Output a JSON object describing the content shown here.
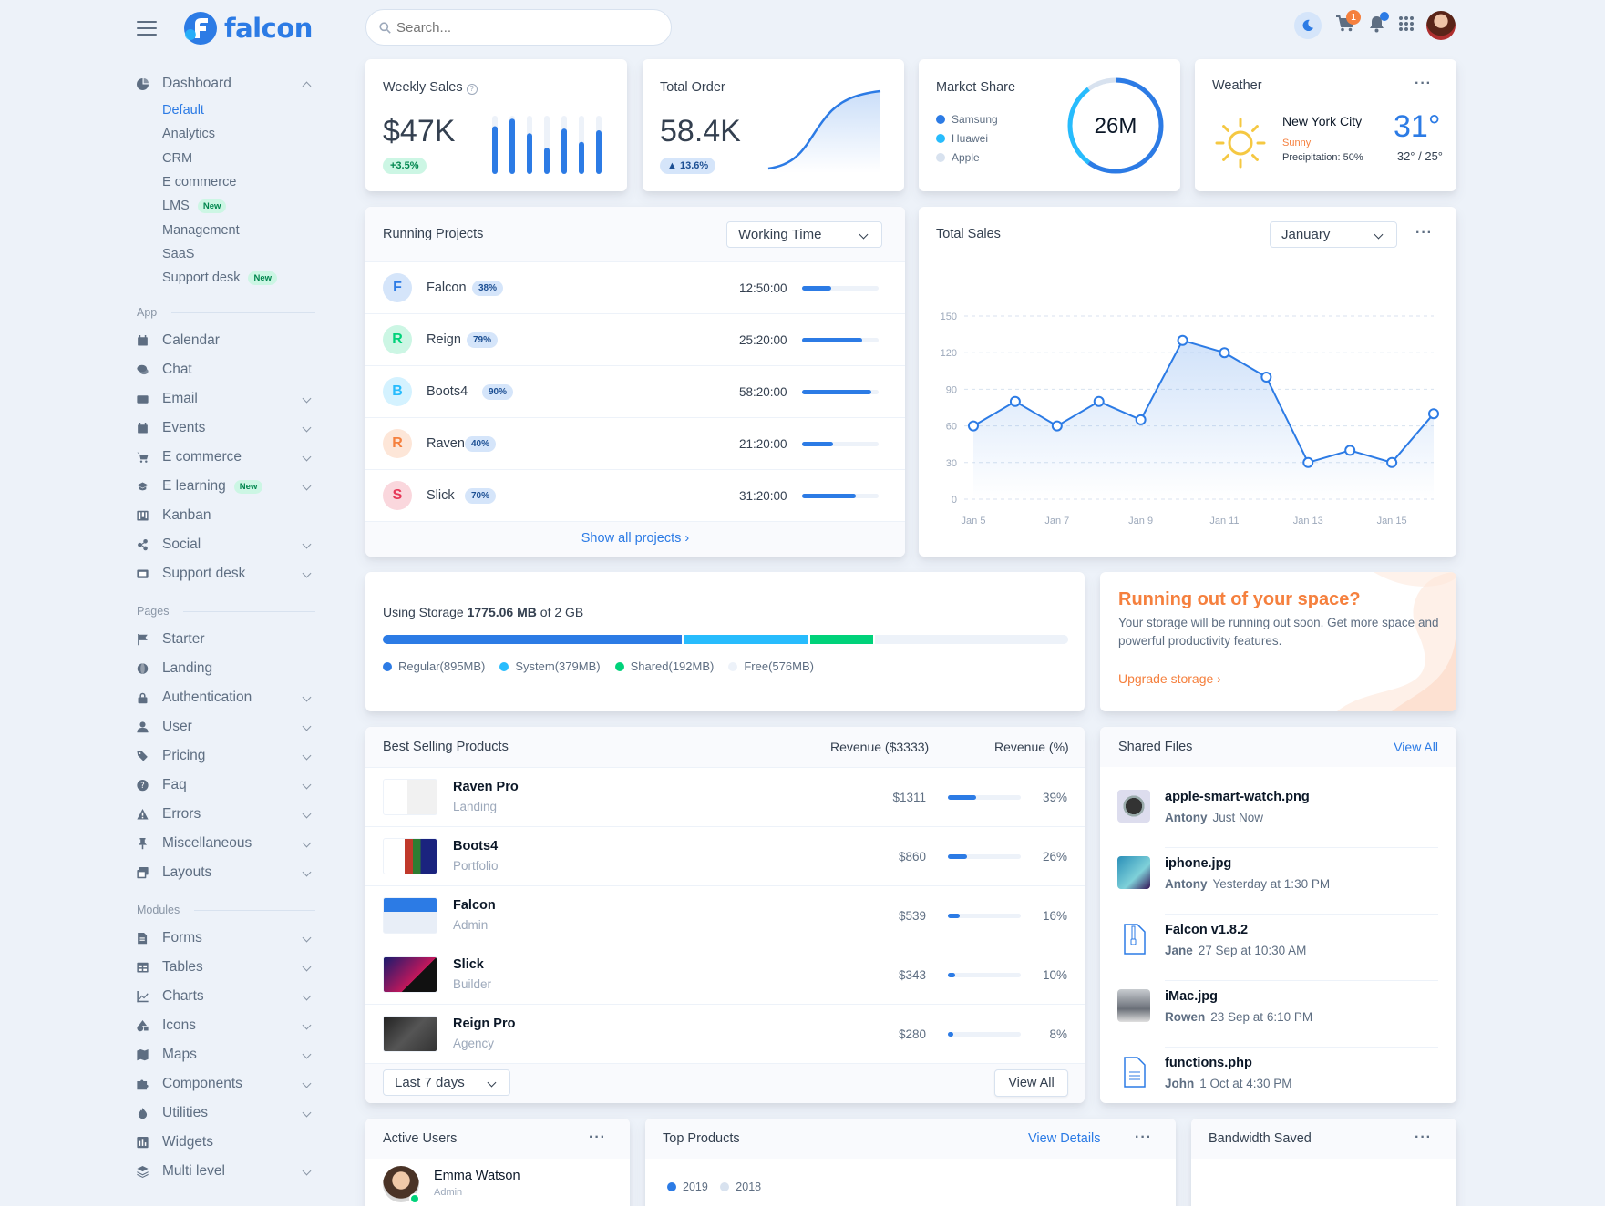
{
  "brand": {
    "name": "falcon"
  },
  "search": {
    "placeholder": "Search..."
  },
  "topbar": {
    "cart_count": "1"
  },
  "sidebar": {
    "dashboard": {
      "label": "Dashboard",
      "items": [
        {
          "label": "Default",
          "active": true
        },
        {
          "label": "Analytics"
        },
        {
          "label": "CRM"
        },
        {
          "label": "E commerce"
        },
        {
          "label": "LMS",
          "badge": "New"
        },
        {
          "label": "Management"
        },
        {
          "label": "SaaS"
        },
        {
          "label": "Support desk",
          "badge": "New"
        }
      ]
    },
    "app_label": "App",
    "app": [
      {
        "label": "Calendar",
        "icon": "calendar-icon",
        "chevron": false
      },
      {
        "label": "Chat",
        "icon": "chat-icon",
        "chevron": false
      },
      {
        "label": "Email",
        "icon": "envelope-icon",
        "chevron": true
      },
      {
        "label": "Events",
        "icon": "calendar-day-icon",
        "chevron": true
      },
      {
        "label": "E commerce",
        "icon": "cart-icon",
        "chevron": true
      },
      {
        "label": "E learning",
        "icon": "graduation-cap-icon",
        "chevron": true,
        "badge": "New"
      },
      {
        "label": "Kanban",
        "icon": "kanban-icon",
        "chevron": false
      },
      {
        "label": "Social",
        "icon": "share-icon",
        "chevron": true
      },
      {
        "label": "Support desk",
        "icon": "ticket-icon",
        "chevron": true
      }
    ],
    "pages_label": "Pages",
    "pages": [
      {
        "label": "Starter",
        "icon": "flag-icon",
        "chevron": false
      },
      {
        "label": "Landing",
        "icon": "globe-icon",
        "chevron": false
      },
      {
        "label": "Authentication",
        "icon": "lock-icon",
        "chevron": true
      },
      {
        "label": "User",
        "icon": "user-icon",
        "chevron": true
      },
      {
        "label": "Pricing",
        "icon": "tags-icon",
        "chevron": true
      },
      {
        "label": "Faq",
        "icon": "question-circle-icon",
        "chevron": true
      },
      {
        "label": "Errors",
        "icon": "warning-icon",
        "chevron": true
      },
      {
        "label": "Miscellaneous",
        "icon": "thumbtack-icon",
        "chevron": true
      },
      {
        "label": "Layouts",
        "icon": "window-restore-icon",
        "chevron": true
      }
    ],
    "modules_label": "Modules",
    "modules": [
      {
        "label": "Forms",
        "icon": "file-alt-icon",
        "chevron": true
      },
      {
        "label": "Tables",
        "icon": "table-icon",
        "chevron": true
      },
      {
        "label": "Charts",
        "icon": "chart-line-icon",
        "chevron": true
      },
      {
        "label": "Icons",
        "icon": "shapes-icon",
        "chevron": true
      },
      {
        "label": "Maps",
        "icon": "map-icon",
        "chevron": true
      },
      {
        "label": "Components",
        "icon": "puzzle-piece-icon",
        "chevron": true
      },
      {
        "label": "Utilities",
        "icon": "fire-icon",
        "chevron": true
      },
      {
        "label": "Widgets",
        "icon": "poll-icon",
        "chevron": false
      },
      {
        "label": "Multi level",
        "icon": "layer-group-icon",
        "chevron": true
      }
    ]
  },
  "weekly_sales": {
    "title": "Weekly Sales",
    "value": "$47K",
    "change": "+3.5%",
    "bars": [
      0.82,
      0.95,
      0.7,
      0.45,
      0.78,
      0.55,
      0.75
    ]
  },
  "total_order": {
    "title": "Total Order",
    "value": "58.4K",
    "change": "13.6%"
  },
  "market_share": {
    "title": "Market Share",
    "center": "26M",
    "legend": [
      "Samsung",
      "Huawei",
      "Apple"
    ],
    "colors": [
      "#2c7be5",
      "#27bcfd",
      "#d8e2ef"
    ]
  },
  "weather": {
    "title": "Weather",
    "city": "New York City",
    "condition": "Sunny",
    "precipitation": "Precipitation: 50%",
    "temp": "31°",
    "range": "32° / 25°"
  },
  "running_projects": {
    "title": "Running Projects",
    "select": "Working Time",
    "show_all": "Show all projects",
    "rows": [
      {
        "initial": "F",
        "name": "Falcon",
        "pct": "38%",
        "progress": 0.38,
        "time": "12:50:00",
        "bg": "#d5e5fa",
        "fg": "#2c7be5"
      },
      {
        "initial": "R",
        "name": "Reign",
        "pct": "79%",
        "progress": 0.79,
        "time": "25:20:00",
        "bg": "#ccf6e4",
        "fg": "#00d27a"
      },
      {
        "initial": "B",
        "name": "Boots4",
        "pct": "90%",
        "progress": 0.9,
        "time": "58:20:00",
        "bg": "#d4f2ff",
        "fg": "#27bcfd"
      },
      {
        "initial": "R",
        "name": "Raven",
        "pct": "40%",
        "progress": 0.4,
        "time": "21:20:00",
        "bg": "#fde6d8",
        "fg": "#f5803e"
      },
      {
        "initial": "S",
        "name": "Slick",
        "pct": "70%",
        "progress": 0.7,
        "time": "31:20:00",
        "bg": "#fad7dd",
        "fg": "#e63757"
      }
    ]
  },
  "total_sales": {
    "title": "Total Sales",
    "select": "January"
  },
  "chart_data": {
    "type": "line",
    "x": [
      "Jan 5",
      "Jan 6",
      "Jan 7",
      "Jan 8",
      "Jan 9",
      "Jan 10",
      "Jan 11",
      "Jan 12",
      "Jan 13",
      "Jan 14",
      "Jan 15",
      "Jan 16"
    ],
    "xticks": [
      "Jan 5",
      "Jan 7",
      "Jan 9",
      "Jan 11",
      "Jan 13",
      "Jan 15"
    ],
    "values": [
      60,
      80,
      60,
      80,
      65,
      130,
      120,
      100,
      30,
      40,
      30,
      70
    ],
    "yticks": [
      "0",
      "30",
      "60",
      "90",
      "120",
      "150"
    ],
    "ylim": [
      0,
      150
    ],
    "grid": true,
    "color": "#2c7be5"
  },
  "storage": {
    "label_pre": "Using Storage ",
    "used": "1775.06 MB",
    "label_post": " of 2 GB",
    "segments": [
      {
        "label": "Regular(895MB)",
        "value": 895,
        "color": "#2c7be5"
      },
      {
        "label": "System(379MB)",
        "value": 379,
        "color": "#27bcfd"
      },
      {
        "label": "Shared(192MB)",
        "value": 192,
        "color": "#00d27a"
      },
      {
        "label": "Free(576MB)",
        "value": 576,
        "color": "#edf2f9"
      }
    ]
  },
  "space_warning": {
    "title": "Running out of your space?",
    "body": "Your storage will be running out soon. Get more space and powerful productivity features.",
    "link": "Upgrade storage"
  },
  "best_selling": {
    "title": "Best Selling Products",
    "col_rev": "Revenue ($3333)",
    "col_pct": "Revenue (%)",
    "filter": "Last 7 days",
    "view_all": "View All",
    "rows": [
      {
        "name": "Raven Pro",
        "sub": "Landing",
        "revenue": "$1311",
        "pct": "39%",
        "progress": 0.39
      },
      {
        "name": "Boots4",
        "sub": "Portfolio",
        "revenue": "$860",
        "pct": "26%",
        "progress": 0.26
      },
      {
        "name": "Falcon",
        "sub": "Admin",
        "revenue": "$539",
        "pct": "16%",
        "progress": 0.16
      },
      {
        "name": "Slick",
        "sub": "Builder",
        "revenue": "$343",
        "pct": "10%",
        "progress": 0.1
      },
      {
        "name": "Reign Pro",
        "sub": "Agency",
        "revenue": "$280",
        "pct": "8%",
        "progress": 0.08
      }
    ]
  },
  "shared_files": {
    "title": "Shared Files",
    "view_all": "View All",
    "rows": [
      {
        "name": "apple-smart-watch.png",
        "user": "Antony",
        "time": "Just Now",
        "icon": "watch-thumbnail"
      },
      {
        "name": "iphone.jpg",
        "user": "Antony",
        "time": "Yesterday at 1:30 PM",
        "icon": "phone-thumbnail"
      },
      {
        "name": "Falcon v1.8.2",
        "user": "Jane",
        "time": "27 Sep at 10:30 AM",
        "icon": "zip-file-icon"
      },
      {
        "name": "iMac.jpg",
        "user": "Rowen",
        "time": "23 Sep at 6:10 PM",
        "icon": "imac-thumbnail"
      },
      {
        "name": "functions.php",
        "user": "John",
        "time": "1 Oct at 4:30 PM",
        "icon": "file-text-icon"
      }
    ]
  },
  "active_users": {
    "title": "Active Users",
    "user": "Emma Watson",
    "role": "Admin"
  },
  "top_products": {
    "title": "Top Products",
    "view": "View Details",
    "legend": [
      "2019",
      "2018"
    ]
  },
  "bandwidth": {
    "title": "Bandwidth Saved"
  }
}
